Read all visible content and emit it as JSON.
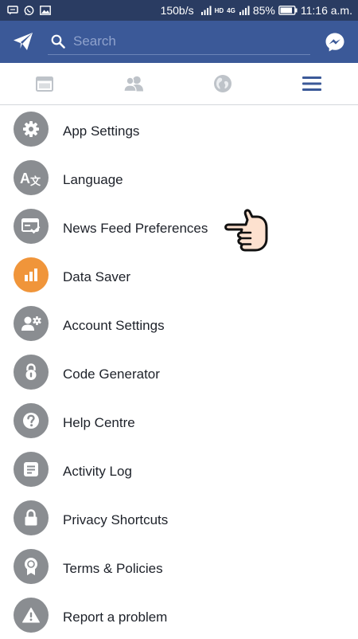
{
  "status_bar": {
    "speed": "150b/s",
    "network_label": "HD",
    "network_type": "4G",
    "battery": "85%",
    "time": "11:16 a.m."
  },
  "app_bar": {
    "search_placeholder": "Search"
  },
  "tabs": [
    "news-feed",
    "friends",
    "notifications",
    "more"
  ],
  "menu": {
    "items": [
      {
        "label": "App Settings",
        "icon": "gear-icon"
      },
      {
        "label": "Language",
        "icon": "language-icon"
      },
      {
        "label": "News Feed Preferences",
        "icon": "news-feed-preferences-icon"
      },
      {
        "label": "Data Saver",
        "icon": "data-saver-icon"
      },
      {
        "label": "Account Settings",
        "icon": "account-settings-icon"
      },
      {
        "label": "Code Generator",
        "icon": "lock-code-icon"
      },
      {
        "label": "Help Centre",
        "icon": "help-icon"
      },
      {
        "label": "Activity Log",
        "icon": "activity-log-icon"
      },
      {
        "label": "Privacy Shortcuts",
        "icon": "privacy-lock-icon"
      },
      {
        "label": "Terms & Policies",
        "icon": "terms-badge-icon"
      },
      {
        "label": "Report a problem",
        "icon": "warning-icon"
      }
    ]
  },
  "colors": {
    "status_bar": "#2a3c62",
    "app_bar": "#3b5998",
    "icon_circle": "#8a8d91",
    "data_saver_accent": "#f0953a",
    "active_tab": "#3b5998"
  }
}
